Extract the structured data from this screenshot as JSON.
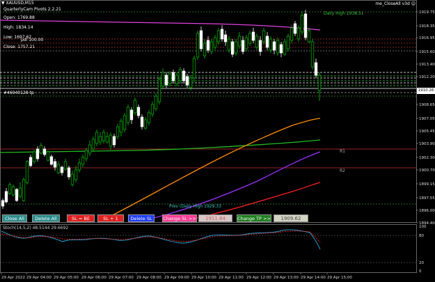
{
  "window": {
    "symbol_title": "XAUUSD,M15",
    "indicator_name": "me_CloseAll v3d",
    "ea_label": "QuarterlyCam Pivots 2.2.21"
  },
  "info_panel": {
    "open": "Open: 1769.88",
    "high": "High: 1834.14",
    "low": "Low: 1697.62",
    "close": "Close: 1757.21",
    "extra": "pdl 100.00",
    "order_line": "#46940128 tp"
  },
  "chart_labels": {
    "daily_high": "Daily High 1938.51",
    "prev_daily_high": "Prev (Daily High 1929.33",
    "r1": "R1",
    "r2": "R2",
    "stoch": "Stoch(14,5,2) 48.5144 29.6692"
  },
  "price_axis": [
    "1919.75",
    "1918.35",
    "1916.95",
    "1915.60",
    "1913.40",
    "1912.20",
    "1910.26",
    "1908.65",
    "1907.05",
    "1905.45",
    "1903.90",
    "1902.30",
    "1900.70",
    "1899.15",
    "1897.55",
    "1896.00",
    "1894.40"
  ],
  "current_price": "1910.26",
  "stoch_axis": [
    "100",
    "80",
    "20",
    "0"
  ],
  "time_axis": [
    "29 Apr 2022",
    "29 Apr 04:00",
    "29 Apr 05:00",
    "29 Apr 06:00",
    "29 Apr 07:00",
    "29 Apr 08:00",
    "29 Apr 09:00",
    "29 Apr 10:00",
    "29 Apr 11:00",
    "29 Apr 12:00",
    "29 Apr 13:00",
    "29 Apr 14:00",
    "29 Apr 15:00"
  ],
  "buttons": {
    "close_all": "Close All",
    "delete_all": "Delete All",
    "sl_be": "SL = BE",
    "sl_plus": "SL + 1",
    "delete_sl": "Delete SL",
    "change_sl": "Change SL >>",
    "sl_value": "1911.84",
    "change_tp": "Change TP >>",
    "tp_value": "1909.62"
  },
  "colors": {
    "background": "#000000",
    "bull_candle": "#ffffff",
    "bear_candle": "#00c000",
    "ma_magenta": "#e040e0",
    "ma_orange": "#ff8c00",
    "ma_green": "#22bb22",
    "ma_purple": "#9b30ff",
    "ma_red": "#ff2020",
    "pivot_red": "#c83232",
    "close_all_btn": "#2a8c8c",
    "sl_btn": "#e02020",
    "delete_sl_btn": "#1e3cff",
    "change_sl_btn": "#ff3c96",
    "change_tp_btn": "#1e7f1e"
  }
}
